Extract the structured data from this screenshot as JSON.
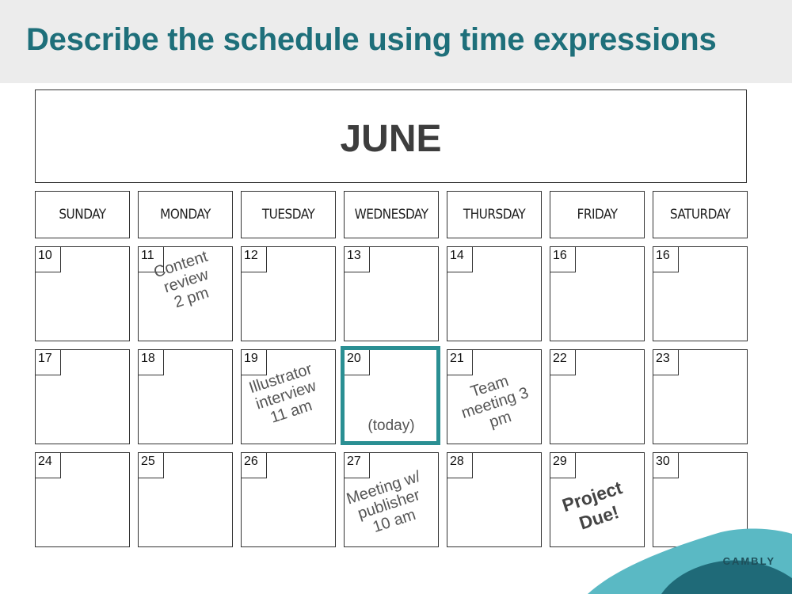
{
  "title": "Describe the schedule using time expressions",
  "month": "JUNE",
  "weekdays": [
    "SUNDAY",
    "MONDAY",
    "TUESDAY",
    "WEDNESDAY",
    "THURSDAY",
    "FRIDAY",
    "SATURDAY"
  ],
  "weeks": [
    [
      "10",
      "11",
      "12",
      "13",
      "14",
      "16",
      "16"
    ],
    [
      "17",
      "18",
      "19",
      "20",
      "21",
      "22",
      "23"
    ],
    [
      "24",
      "25",
      "26",
      "27",
      "28",
      "29",
      "30"
    ]
  ],
  "events": {
    "content_review": [
      "Content",
      "review",
      "2 pm"
    ],
    "illustrator_interview": [
      "Illustrator",
      "interview",
      "11 am"
    ],
    "team_meeting": [
      "Team",
      "meeting  3",
      "pm"
    ],
    "meeting_publisher": [
      "Meeting w/",
      "publisher",
      "10 am"
    ],
    "project_due": [
      "Project",
      "Due!"
    ]
  },
  "today_label": "(today)",
  "brand": "CAMBLY",
  "colors": {
    "accent": "#2a8f93",
    "title": "#1e6f7a",
    "header_bg": "#ececec",
    "wave_light": "#5ab9c4",
    "wave_dark": "#1f6a78"
  }
}
